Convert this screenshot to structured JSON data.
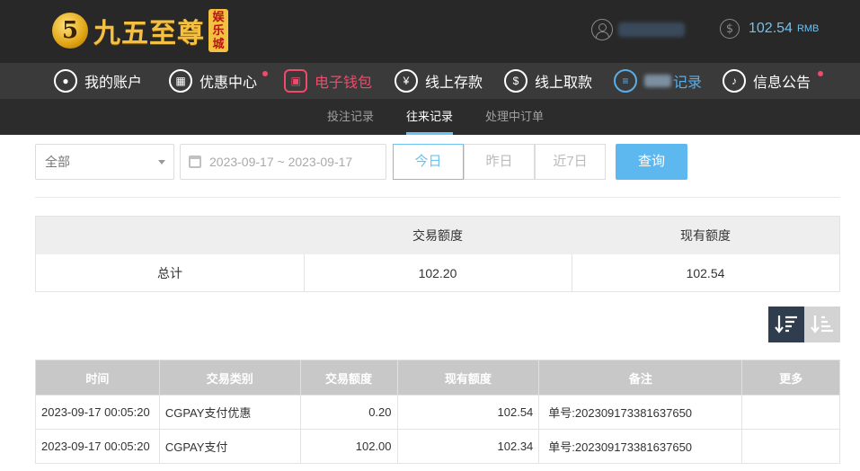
{
  "header": {
    "logo_mark": "5",
    "logo_text": "九五至尊",
    "logo_badge": [
      "娱",
      "乐",
      "城"
    ],
    "balance_amount": "102.54",
    "balance_currency": "RMB",
    "balance_icon": "$"
  },
  "main_nav": [
    {
      "label": "我的账户",
      "icon": "user-icon"
    },
    {
      "label": "优惠中心",
      "icon": "gift-icon",
      "badge": true
    },
    {
      "label": "电子钱包",
      "icon": "wallet-icon",
      "state": "active-red"
    },
    {
      "label": "线上存款",
      "icon": "deposit-icon"
    },
    {
      "label": "线上取款",
      "icon": "withdraw-icon"
    },
    {
      "label": "记录",
      "icon": "records-icon",
      "state": "active-blue"
    },
    {
      "label": "信息公告",
      "icon": "bell-icon",
      "badge": true
    }
  ],
  "sub_nav": [
    {
      "label": "投注记录"
    },
    {
      "label": "往来记录",
      "active": true
    },
    {
      "label": "处理中订单"
    }
  ],
  "filters": {
    "type_select": "全部",
    "date_range": "2023-09-17 ~ 2023-09-17",
    "quick": [
      "今日",
      "昨日",
      "近7日"
    ],
    "search_label": "查询"
  },
  "summary": {
    "headers": [
      "交易额度",
      "现有额度"
    ],
    "row_label": "总计",
    "trade_amount": "102.20",
    "current_amount": "102.54"
  },
  "table": {
    "headers": [
      "时间",
      "交易类别",
      "交易额度",
      "现有额度",
      "备注",
      "更多"
    ],
    "rows": [
      [
        "2023-09-17 00:05:20",
        "CGPAY支付优惠",
        "0.20",
        "102.54",
        "单号:202309173381637650",
        ""
      ],
      [
        "2023-09-17 00:05:20",
        "CGPAY支付",
        "102.00",
        "102.34",
        "单号:202309173381637650",
        ""
      ]
    ]
  },
  "colors": {
    "accent_blue": "#6cc2f0",
    "accent_red": "#f04a6a",
    "header_bg": "#282828"
  }
}
